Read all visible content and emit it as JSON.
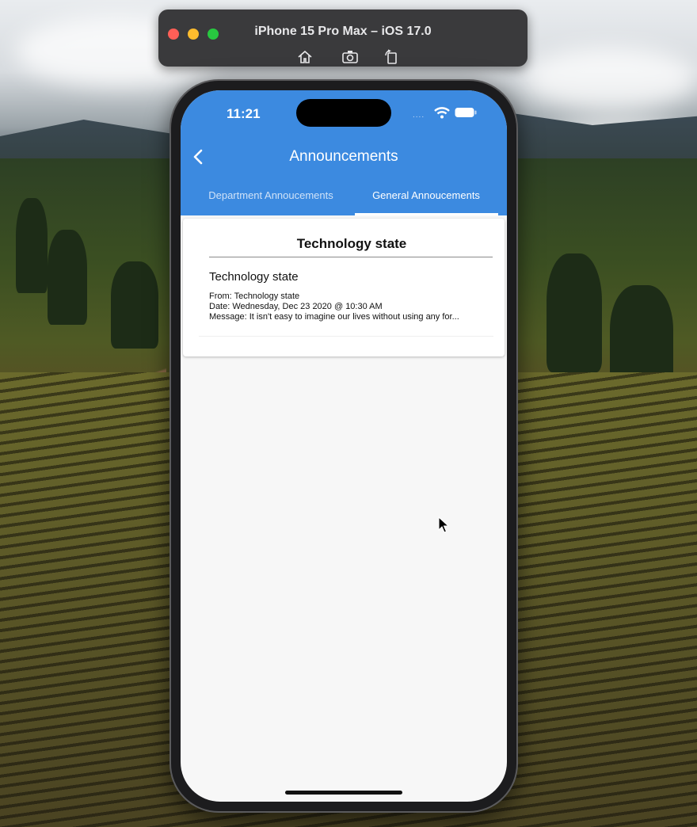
{
  "simulator": {
    "title": "iPhone 15 Pro Max – iOS 17.0",
    "tools": [
      "home-icon",
      "screenshot-icon",
      "rotate-icon"
    ]
  },
  "status_bar": {
    "time": "11:21",
    "dots": "....",
    "icons": [
      "wifi-icon",
      "battery-icon"
    ]
  },
  "app_bar": {
    "title": "Announcements",
    "back_icon": "chevron-left-icon",
    "color": "#3c8ae0"
  },
  "tabs": [
    {
      "label": "Department Annoucements",
      "selected": false
    },
    {
      "label": "General Annoucements",
      "selected": true
    }
  ],
  "card": {
    "title": "Technology state",
    "items": [
      {
        "title": "Technology state",
        "from": "From: Technology state",
        "date": "Date: Wednesday, Dec 23 2020 @ 10:30 AM",
        "message": "Message: It isn't easy to imagine our lives without using any for..."
      }
    ]
  }
}
